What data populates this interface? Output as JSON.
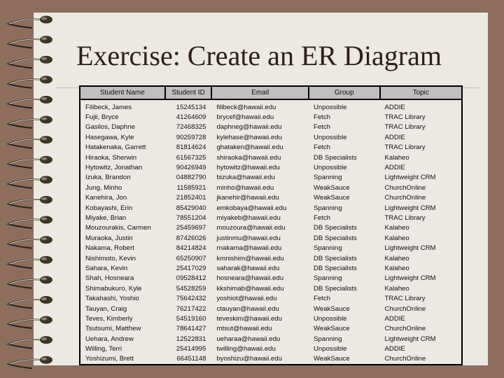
{
  "slide": {
    "title": "Exercise: Create an ER Diagram",
    "colors": {
      "background": "#8d6e5c",
      "paper": "#ece8e3",
      "header": "#c0c0c0"
    }
  },
  "table": {
    "headers": [
      "Student Name",
      "Student ID",
      "Email",
      "Group",
      "Topic"
    ],
    "rows": [
      [
        "Filibeck, James",
        "15245134",
        "filibeck@hawaii.edu",
        "Unpossible",
        "ADDIE"
      ],
      [
        "Fujii, Bryce",
        "41264609",
        "brycef@hawaii.edu",
        "Fetch",
        "TRAC Library"
      ],
      [
        "Gasilos, Daphne",
        "72468325",
        "daphneg@hawaii.edu",
        "Fetch",
        "TRAC Library"
      ],
      [
        "Hasegawa, Kyle",
        "90259728",
        "kylehase@hawaii.edu",
        "Unpossible",
        "ADDIE"
      ],
      [
        "Hatakenaka, Garrett",
        "81814624",
        "ghataken@hawaii.edu",
        "Fetch",
        "TRAC Library"
      ],
      [
        "Hiraoka, Sherwin",
        "61567325",
        "shiraoka@hawaii.edu",
        "DB Specialists",
        "Kalaheo"
      ],
      [
        "Hytowitz, Jonathan",
        "90426949",
        "hytowitz@hawaii.edu",
        "Unpossible",
        "ADDIE"
      ],
      [
        "Izuka, Brandon",
        "04882790",
        "bizuka@hawaii.edu",
        "Spanning",
        "Lightweight CRM"
      ],
      [
        "Jung, Minho",
        "11585921",
        "minho@hawaii.edu",
        "WeakSauce",
        "ChurchOnline"
      ],
      [
        "Kanehira, Jon",
        "21852401",
        "jkanehir@hawaii.edu",
        "WeakSauce",
        "ChurchOnline"
      ],
      [
        "Kobayashi, Erin",
        "85429040",
        "emkobaya@hawaii.edu",
        "Spanning",
        "Lightweight CRM"
      ],
      [
        "Miyake, Brian",
        "78551204",
        "miyakeb@hawaii.edu",
        "Fetch",
        "TRAC Library"
      ],
      [
        "Mouzourakis, Carmen",
        "25459697",
        "mouzoura@hawaii.edu",
        "DB Specialists",
        "Kalaheo"
      ],
      [
        "Muraoka, Justin",
        "87426026",
        "justinmu@hawaii.edu",
        "DB Specialists",
        "Kalaheo"
      ],
      [
        "Nakama, Robert",
        "84214824",
        "rnakama@hawaii.edu",
        "Spanning",
        "Lightweight CRM"
      ],
      [
        "Nishimoto, Kevin",
        "65250907",
        "kmnishim@hawaii.edu",
        "DB Specialists",
        "Kalaheo"
      ],
      [
        "Sahara, Kevin",
        "25417029",
        "saharak@hawaii.edu",
        "DB Specialists",
        "Kalaheo"
      ],
      [
        "Shah, Hosneara",
        "09528412",
        "hosneara@hawaii.edu",
        "Spanning",
        "Lightweight CRM"
      ],
      [
        "Shimabukuro, Kyle",
        "54528259",
        "kkshimab@hawaii.edu",
        "DB Specialists",
        "Kalaheo"
      ],
      [
        "Takahashi, Yoshio",
        "75642432",
        "yoshiot@hawaii.edu",
        "Fetch",
        "TRAC Library"
      ],
      [
        "Tauyan, Craig",
        "76217422",
        "ctauyan@hawaii.edu",
        "WeakSauce",
        "ChurchOnline"
      ],
      [
        "Teves, Kimberly",
        "54519160",
        "teveskim@hawaii.edu",
        "Unpossible",
        "ADDIE"
      ],
      [
        "Tsutsumi, Matthew",
        "78641427",
        "mtsut@hawaii.edu",
        "WeakSauce",
        "ChurchOnline"
      ],
      [
        "Uehara, Andrew",
        "12522831",
        "ueharaa@hawaii.edu",
        "Spanning",
        "Lightweight CRM"
      ],
      [
        "Willing, Terri",
        "25414995",
        "twilling@hawaii.edu",
        "Unpossible",
        "ADDIE"
      ],
      [
        "Yoshizumi, Brett",
        "66451148",
        "byoshizu@hawaii.edu",
        "WeakSauce",
        "ChurchOnline"
      ]
    ]
  }
}
